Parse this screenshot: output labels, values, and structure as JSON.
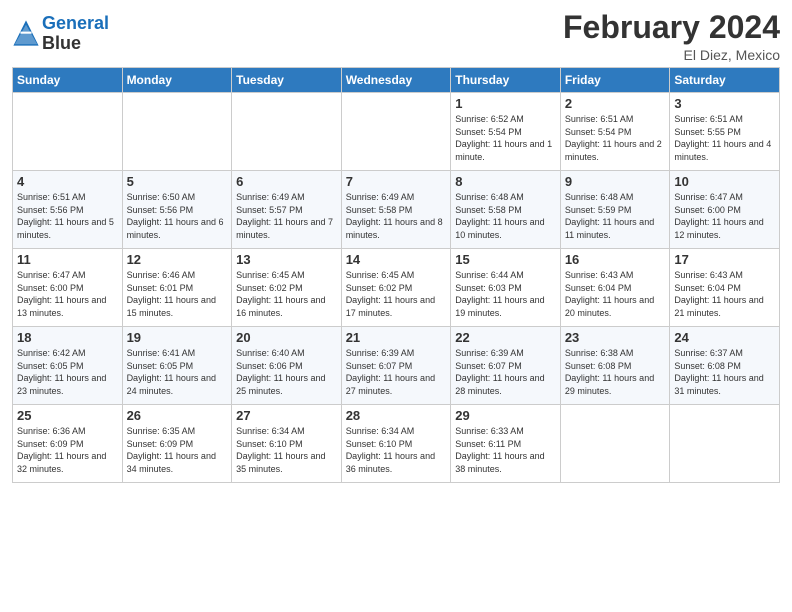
{
  "logo": {
    "line1": "General",
    "line2": "Blue"
  },
  "header": {
    "month_year": "February 2024",
    "location": "El Diez, Mexico"
  },
  "weekdays": [
    "Sunday",
    "Monday",
    "Tuesday",
    "Wednesday",
    "Thursday",
    "Friday",
    "Saturday"
  ],
  "weeks": [
    [
      {
        "day": "",
        "info": ""
      },
      {
        "day": "",
        "info": ""
      },
      {
        "day": "",
        "info": ""
      },
      {
        "day": "",
        "info": ""
      },
      {
        "day": "1",
        "info": "Sunrise: 6:52 AM\nSunset: 5:54 PM\nDaylight: 11 hours and 1 minute."
      },
      {
        "day": "2",
        "info": "Sunrise: 6:51 AM\nSunset: 5:54 PM\nDaylight: 11 hours and 2 minutes."
      },
      {
        "day": "3",
        "info": "Sunrise: 6:51 AM\nSunset: 5:55 PM\nDaylight: 11 hours and 4 minutes."
      }
    ],
    [
      {
        "day": "4",
        "info": "Sunrise: 6:51 AM\nSunset: 5:56 PM\nDaylight: 11 hours and 5 minutes."
      },
      {
        "day": "5",
        "info": "Sunrise: 6:50 AM\nSunset: 5:56 PM\nDaylight: 11 hours and 6 minutes."
      },
      {
        "day": "6",
        "info": "Sunrise: 6:49 AM\nSunset: 5:57 PM\nDaylight: 11 hours and 7 minutes."
      },
      {
        "day": "7",
        "info": "Sunrise: 6:49 AM\nSunset: 5:58 PM\nDaylight: 11 hours and 8 minutes."
      },
      {
        "day": "8",
        "info": "Sunrise: 6:48 AM\nSunset: 5:58 PM\nDaylight: 11 hours and 10 minutes."
      },
      {
        "day": "9",
        "info": "Sunrise: 6:48 AM\nSunset: 5:59 PM\nDaylight: 11 hours and 11 minutes."
      },
      {
        "day": "10",
        "info": "Sunrise: 6:47 AM\nSunset: 6:00 PM\nDaylight: 11 hours and 12 minutes."
      }
    ],
    [
      {
        "day": "11",
        "info": "Sunrise: 6:47 AM\nSunset: 6:00 PM\nDaylight: 11 hours and 13 minutes."
      },
      {
        "day": "12",
        "info": "Sunrise: 6:46 AM\nSunset: 6:01 PM\nDaylight: 11 hours and 15 minutes."
      },
      {
        "day": "13",
        "info": "Sunrise: 6:45 AM\nSunset: 6:02 PM\nDaylight: 11 hours and 16 minutes."
      },
      {
        "day": "14",
        "info": "Sunrise: 6:45 AM\nSunset: 6:02 PM\nDaylight: 11 hours and 17 minutes."
      },
      {
        "day": "15",
        "info": "Sunrise: 6:44 AM\nSunset: 6:03 PM\nDaylight: 11 hours and 19 minutes."
      },
      {
        "day": "16",
        "info": "Sunrise: 6:43 AM\nSunset: 6:04 PM\nDaylight: 11 hours and 20 minutes."
      },
      {
        "day": "17",
        "info": "Sunrise: 6:43 AM\nSunset: 6:04 PM\nDaylight: 11 hours and 21 minutes."
      }
    ],
    [
      {
        "day": "18",
        "info": "Sunrise: 6:42 AM\nSunset: 6:05 PM\nDaylight: 11 hours and 23 minutes."
      },
      {
        "day": "19",
        "info": "Sunrise: 6:41 AM\nSunset: 6:05 PM\nDaylight: 11 hours and 24 minutes."
      },
      {
        "day": "20",
        "info": "Sunrise: 6:40 AM\nSunset: 6:06 PM\nDaylight: 11 hours and 25 minutes."
      },
      {
        "day": "21",
        "info": "Sunrise: 6:39 AM\nSunset: 6:07 PM\nDaylight: 11 hours and 27 minutes."
      },
      {
        "day": "22",
        "info": "Sunrise: 6:39 AM\nSunset: 6:07 PM\nDaylight: 11 hours and 28 minutes."
      },
      {
        "day": "23",
        "info": "Sunrise: 6:38 AM\nSunset: 6:08 PM\nDaylight: 11 hours and 29 minutes."
      },
      {
        "day": "24",
        "info": "Sunrise: 6:37 AM\nSunset: 6:08 PM\nDaylight: 11 hours and 31 minutes."
      }
    ],
    [
      {
        "day": "25",
        "info": "Sunrise: 6:36 AM\nSunset: 6:09 PM\nDaylight: 11 hours and 32 minutes."
      },
      {
        "day": "26",
        "info": "Sunrise: 6:35 AM\nSunset: 6:09 PM\nDaylight: 11 hours and 34 minutes."
      },
      {
        "day": "27",
        "info": "Sunrise: 6:34 AM\nSunset: 6:10 PM\nDaylight: 11 hours and 35 minutes."
      },
      {
        "day": "28",
        "info": "Sunrise: 6:34 AM\nSunset: 6:10 PM\nDaylight: 11 hours and 36 minutes."
      },
      {
        "day": "29",
        "info": "Sunrise: 6:33 AM\nSunset: 6:11 PM\nDaylight: 11 hours and 38 minutes."
      },
      {
        "day": "",
        "info": ""
      },
      {
        "day": "",
        "info": ""
      }
    ]
  ]
}
